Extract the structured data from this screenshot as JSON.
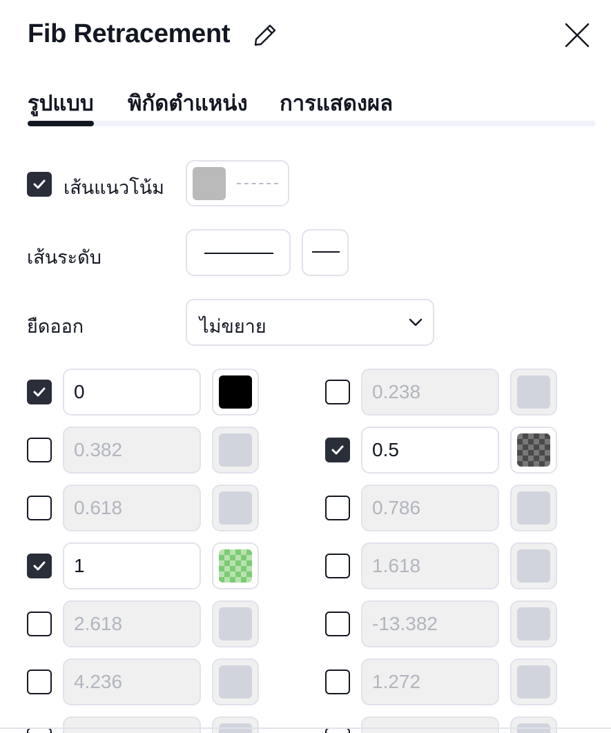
{
  "header": {
    "title": "Fib Retracement"
  },
  "tabs": [
    {
      "label": "รูปแบบ",
      "active": true
    },
    {
      "label": "พิกัดตำแหน่ง",
      "active": false
    },
    {
      "label": "การแสดงผล",
      "active": false
    }
  ],
  "trend_line": {
    "label": "เส้นแนวโน้ม",
    "checked": true,
    "color": "#bababa"
  },
  "levels_line": {
    "label": "เส้นระดับ"
  },
  "extend": {
    "label": "ยืดออก",
    "value": "ไม่ขยาย"
  },
  "levels": [
    {
      "value": "0",
      "checked": true,
      "color": "#000000"
    },
    {
      "value": "0.238",
      "checked": false,
      "color": "#d1d4dc"
    },
    {
      "value": "0.382",
      "checked": false,
      "color": "#d1d4dc"
    },
    {
      "value": "0.5",
      "checked": true,
      "color": "checker-dark"
    },
    {
      "value": "0.618",
      "checked": false,
      "color": "#d1d4dc"
    },
    {
      "value": "0.786",
      "checked": false,
      "color": "#d1d4dc"
    },
    {
      "value": "1",
      "checked": true,
      "color": "checker-green"
    },
    {
      "value": "1.618",
      "checked": false,
      "color": "#d1d4dc"
    },
    {
      "value": "2.618",
      "checked": false,
      "color": "#d1d4dc"
    },
    {
      "value": "-13.382",
      "checked": false,
      "color": "#d1d4dc"
    },
    {
      "value": "4.236",
      "checked": false,
      "color": "#d1d4dc"
    },
    {
      "value": "1.272",
      "checked": false,
      "color": "#d1d4dc"
    }
  ]
}
